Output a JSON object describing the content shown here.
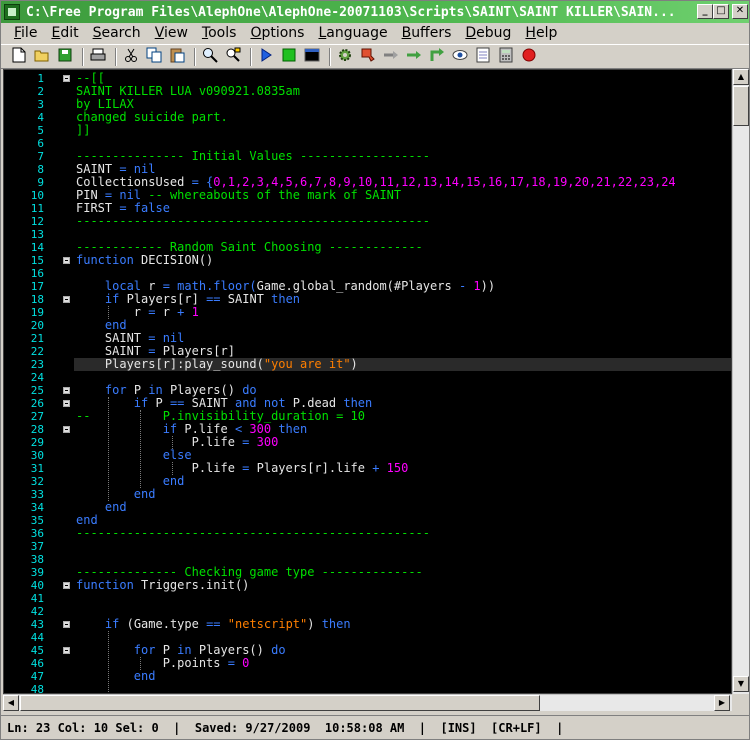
{
  "window": {
    "title": "C:\\Free Program Files\\AlephOne\\AlephOne-20071103\\Scripts\\SAINT\\SAINT KILLER\\SAIN...",
    "minimize_label": "_",
    "maximize_label": "□",
    "close_label": "✕"
  },
  "menu": [
    {
      "label": "File",
      "u": "F",
      "rest": "ile"
    },
    {
      "label": "Edit",
      "u": "E",
      "rest": "dit"
    },
    {
      "label": "Search",
      "u": "S",
      "rest": "earch"
    },
    {
      "label": "View",
      "u": "V",
      "rest": "iew"
    },
    {
      "label": "Tools",
      "u": "T",
      "rest": "ools"
    },
    {
      "label": "Options",
      "u": "O",
      "rest": "ptions"
    },
    {
      "label": "Language",
      "u": "L",
      "rest": "anguage"
    },
    {
      "label": "Buffers",
      "u": "B",
      "rest": "uffers"
    },
    {
      "label": "Debug",
      "u": "D",
      "rest": "ebug"
    },
    {
      "label": "Help",
      "u": "H",
      "rest": "elp"
    }
  ],
  "toolbar_icons": [
    "new-file-icon",
    "open-folder-icon",
    "save-icon",
    "|",
    "print-icon",
    "|",
    "cut-icon",
    "copy-icon",
    "paste-icon",
    "|",
    "find-icon",
    "replace-icon",
    "|",
    "run-icon",
    "stop-icon",
    "console-icon",
    "|",
    "settings-icon",
    "bookmark-icon",
    "step-into-icon",
    "step-over-icon",
    "step-out-icon",
    "watch-icon",
    "breakpoints-icon",
    "calculator-icon",
    "record-icon"
  ],
  "colors": {
    "line_number": "#00e0e0",
    "comment": "#00e000",
    "keyword": "#3a7cff",
    "number": "#ff00ff",
    "string": "#ff7f00",
    "identifier": "#e6e6e6",
    "background": "#000000"
  },
  "editor": {
    "current_line": 23,
    "lines": [
      {
        "n": "1",
        "fold": true,
        "tokens": [
          [
            "c",
            "--[["
          ]
        ]
      },
      {
        "n": "2",
        "tokens": [
          [
            "c",
            "SAINT KILLER LUA v090921.0835am"
          ]
        ]
      },
      {
        "n": "3",
        "tokens": [
          [
            "c",
            "by LILAX"
          ]
        ]
      },
      {
        "n": "4",
        "tokens": [
          [
            "c",
            "changed suicide part."
          ]
        ]
      },
      {
        "n": "5",
        "tokens": [
          [
            "c",
            "]]"
          ]
        ]
      },
      {
        "n": "6",
        "tokens": []
      },
      {
        "n": "7",
        "tokens": [
          [
            "c",
            "--------------- Initial Values ------------------"
          ]
        ]
      },
      {
        "n": "8",
        "tokens": [
          [
            "i",
            "SAINT "
          ],
          [
            "k",
            "= nil"
          ]
        ]
      },
      {
        "n": "9",
        "tokens": [
          [
            "i",
            "CollectionsUsed "
          ],
          [
            "k",
            "= {"
          ],
          [
            "m",
            "0,1,2,3,4,5,6,7,8,9,10,11,12,13,14,15,16,17,18,19,20,21,22,23,24"
          ]
        ]
      },
      {
        "n": "10",
        "tokens": [
          [
            "i",
            "PIN "
          ],
          [
            "k",
            "= nil "
          ],
          [
            "c",
            "-- whereabouts of the mark of SAINT"
          ]
        ]
      },
      {
        "n": "11",
        "tokens": [
          [
            "i",
            "FIRST "
          ],
          [
            "k",
            "= false"
          ]
        ]
      },
      {
        "n": "12",
        "tokens": [
          [
            "c",
            "-------------------------------------------------"
          ]
        ]
      },
      {
        "n": "13",
        "tokens": []
      },
      {
        "n": "14",
        "tokens": [
          [
            "c",
            "------------ Random Saint Choosing -------------"
          ]
        ]
      },
      {
        "n": "15",
        "fold": true,
        "tokens": [
          [
            "k",
            "function "
          ],
          [
            "i",
            "DECISION()"
          ]
        ]
      },
      {
        "n": "16",
        "tokens": []
      },
      {
        "n": "17",
        "tokens": [
          [
            "i",
            "    "
          ],
          [
            "k",
            "local "
          ],
          [
            "i",
            "r "
          ],
          [
            "k",
            "= math.floor("
          ],
          [
            "i",
            "Game.global_random(#Players "
          ],
          [
            "k",
            "- "
          ],
          [
            "m",
            "1"
          ],
          [
            "i",
            "))"
          ]
        ]
      },
      {
        "n": "18",
        "fold": true,
        "tokens": [
          [
            "i",
            "    "
          ],
          [
            "k",
            "if "
          ],
          [
            "i",
            "Players[r] "
          ],
          [
            "k",
            "== "
          ],
          [
            "i",
            "SAINT "
          ],
          [
            "k",
            "then"
          ]
        ]
      },
      {
        "n": "19",
        "tokens": [
          [
            "i",
            "        r "
          ],
          [
            "k",
            "= "
          ],
          [
            "i",
            "r "
          ],
          [
            "k",
            "+ "
          ],
          [
            "m",
            "1"
          ]
        ]
      },
      {
        "n": "20",
        "tokens": [
          [
            "i",
            "    "
          ],
          [
            "k",
            "end"
          ]
        ]
      },
      {
        "n": "21",
        "tokens": [
          [
            "i",
            "    SAINT "
          ],
          [
            "k",
            "= nil"
          ]
        ]
      },
      {
        "n": "22",
        "tokens": [
          [
            "i",
            "    SAINT "
          ],
          [
            "k",
            "= "
          ],
          [
            "i",
            "Players[r]"
          ]
        ]
      },
      {
        "n": "23",
        "tokens": [
          [
            "i",
            "    Players[r]:play_sound("
          ],
          [
            "s",
            "\"you are it\""
          ],
          [
            "i",
            ")"
          ]
        ]
      },
      {
        "n": "24",
        "tokens": []
      },
      {
        "n": "25",
        "fold": true,
        "tokens": [
          [
            "i",
            "    "
          ],
          [
            "k",
            "for "
          ],
          [
            "i",
            "P "
          ],
          [
            "k",
            "in "
          ],
          [
            "i",
            "Players() "
          ],
          [
            "k",
            "do"
          ]
        ]
      },
      {
        "n": "26",
        "fold": true,
        "tokens": [
          [
            "i",
            "        "
          ],
          [
            "k",
            "if "
          ],
          [
            "i",
            "P "
          ],
          [
            "k",
            "== "
          ],
          [
            "i",
            "SAINT "
          ],
          [
            "k",
            "and not "
          ],
          [
            "i",
            "P.dead "
          ],
          [
            "k",
            "then"
          ]
        ]
      },
      {
        "n": "27",
        "tokens": [
          [
            "c",
            "--          P.invisibility_duration = 10"
          ]
        ]
      },
      {
        "n": "28",
        "fold": true,
        "tokens": [
          [
            "i",
            "            "
          ],
          [
            "k",
            "if "
          ],
          [
            "i",
            "P.life "
          ],
          [
            "k",
            "< "
          ],
          [
            "m",
            "300 "
          ],
          [
            "k",
            "then"
          ]
        ]
      },
      {
        "n": "29",
        "tokens": [
          [
            "i",
            "                P.life "
          ],
          [
            "k",
            "= "
          ],
          [
            "m",
            "300"
          ]
        ]
      },
      {
        "n": "30",
        "tokens": [
          [
            "i",
            "            "
          ],
          [
            "k",
            "else"
          ]
        ]
      },
      {
        "n": "31",
        "tokens": [
          [
            "i",
            "                P.life "
          ],
          [
            "k",
            "= "
          ],
          [
            "i",
            "Players[r].life "
          ],
          [
            "k",
            "+ "
          ],
          [
            "m",
            "150"
          ]
        ]
      },
      {
        "n": "32",
        "tokens": [
          [
            "i",
            "            "
          ],
          [
            "k",
            "end"
          ]
        ]
      },
      {
        "n": "33",
        "tokens": [
          [
            "i",
            "        "
          ],
          [
            "k",
            "end"
          ]
        ]
      },
      {
        "n": "34",
        "tokens": [
          [
            "i",
            "    "
          ],
          [
            "k",
            "end"
          ]
        ]
      },
      {
        "n": "35",
        "tokens": [
          [
            "k",
            "end"
          ]
        ]
      },
      {
        "n": "36",
        "tokens": [
          [
            "c",
            "-------------------------------------------------"
          ]
        ]
      },
      {
        "n": "37",
        "tokens": []
      },
      {
        "n": "38",
        "tokens": []
      },
      {
        "n": "39",
        "tokens": [
          [
            "c",
            "-------------- Checking game type --------------"
          ]
        ]
      },
      {
        "n": "40",
        "fold": true,
        "tokens": [
          [
            "k",
            "function "
          ],
          [
            "i",
            "Triggers.init()"
          ]
        ]
      },
      {
        "n": "41",
        "tokens": []
      },
      {
        "n": "42",
        "tokens": []
      },
      {
        "n": "43",
        "fold": true,
        "tokens": [
          [
            "i",
            "    "
          ],
          [
            "k",
            "if "
          ],
          [
            "i",
            "(Game.type "
          ],
          [
            "k",
            "== "
          ],
          [
            "s",
            "\"netscript\""
          ],
          [
            "i",
            ") "
          ],
          [
            "k",
            "then"
          ]
        ]
      },
      {
        "n": "44",
        "tokens": []
      },
      {
        "n": "45",
        "fold": true,
        "tokens": [
          [
            "i",
            "        "
          ],
          [
            "k",
            "for "
          ],
          [
            "i",
            "P "
          ],
          [
            "k",
            "in "
          ],
          [
            "i",
            "Players() "
          ],
          [
            "k",
            "do"
          ]
        ]
      },
      {
        "n": "46",
        "tokens": [
          [
            "i",
            "            P.points "
          ],
          [
            "k",
            "= "
          ],
          [
            "m",
            "0"
          ]
        ]
      },
      {
        "n": "47",
        "tokens": [
          [
            "i",
            "        "
          ],
          [
            "k",
            "end"
          ]
        ]
      },
      {
        "n": "48",
        "tokens": []
      }
    ]
  },
  "status": {
    "text": "Ln: 23 Col: 10 Sel: 0  |  Saved: 9/27/2009  10:58:08 AM  |  [INS]  [CR+LF]  |"
  }
}
